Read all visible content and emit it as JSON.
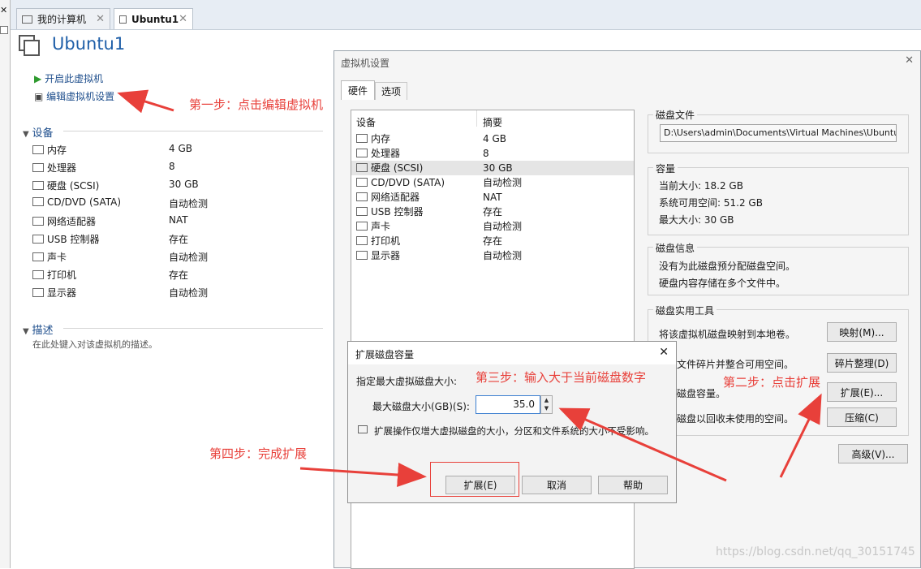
{
  "tabs": [
    {
      "label": "我的计算机"
    },
    {
      "label": "Ubuntu1"
    }
  ],
  "vm": {
    "title": "Ubuntu1",
    "start_link": "开启此虚拟机",
    "edit_link": "编辑虚拟机设置"
  },
  "devices": {
    "header": "设备",
    "items": [
      {
        "label": "内存",
        "value": "4 GB",
        "icon": "memory-icon"
      },
      {
        "label": "处理器",
        "value": "8",
        "icon": "cpu-icon"
      },
      {
        "label": "硬盘 (SCSI)",
        "value": "30 GB",
        "icon": "hard-disk-icon"
      },
      {
        "label": "CD/DVD (SATA)",
        "value": "自动检测",
        "icon": "cd-icon"
      },
      {
        "label": "网络适配器",
        "value": "NAT",
        "icon": "network-icon"
      },
      {
        "label": "USB 控制器",
        "value": "存在",
        "icon": "usb-icon"
      },
      {
        "label": "声卡",
        "value": "自动检测",
        "icon": "speaker-icon"
      },
      {
        "label": "打印机",
        "value": "存在",
        "icon": "printer-icon"
      },
      {
        "label": "显示器",
        "value": "自动检测",
        "icon": "monitor-icon"
      }
    ]
  },
  "description": {
    "header": "描述",
    "placeholder": "在此处键入对该虚拟机的描述。"
  },
  "settings": {
    "title": "虚拟机设置",
    "tabs": [
      "硬件",
      "选项"
    ],
    "col_device": "设备",
    "col_summary": "摘要",
    "hw": [
      {
        "label": "内存",
        "value": "4 GB"
      },
      {
        "label": "处理器",
        "value": "8"
      },
      {
        "label": "硬盘 (SCSI)",
        "value": "30 GB"
      },
      {
        "label": "CD/DVD (SATA)",
        "value": "自动检测"
      },
      {
        "label": "网络适配器",
        "value": "NAT"
      },
      {
        "label": "USB 控制器",
        "value": "存在"
      },
      {
        "label": "声卡",
        "value": "自动检测"
      },
      {
        "label": "打印机",
        "value": "存在"
      },
      {
        "label": "显示器",
        "value": "自动检测"
      }
    ],
    "disk_file": {
      "label": "磁盘文件",
      "value": "D:\\Users\\admin\\Documents\\Virtual Machines\\Ubuntu"
    },
    "capacity": {
      "label": "容量",
      "current": "当前大小: 18.2 GB",
      "free": "系统可用空间: 51.2 GB",
      "max": "最大大小: 30 GB"
    },
    "disk_info": {
      "label": "磁盘信息",
      "line1": "没有为此磁盘预分配磁盘空间。",
      "line2": "硬盘内容存储在多个文件中。"
    },
    "utilities": {
      "label": "磁盘实用工具",
      "map_text": "将该虚拟机磁盘映射到本地卷。",
      "map_btn": "映射(M)...",
      "defrag_text": "文件碎片并整合可用空间。",
      "defrag_btn": "碎片整理(D)",
      "expand_text": "磁盘容量。",
      "expand_btn": "扩展(E)...",
      "compact_text": "磁盘以回收未使用的空间。",
      "compact_btn": "压缩(C)"
    },
    "advanced_btn": "高级(V)..."
  },
  "expand_dialog": {
    "title": "扩展磁盘容量",
    "prompt": "指定最大虚拟磁盘大小:",
    "field_label": "最大磁盘大小(GB)(S):",
    "field_value": "35.0",
    "info": "扩展操作仅增大虚拟磁盘的大小，分区和文件系统的大小不受影响。",
    "btn_expand": "扩展(E)",
    "btn_cancel": "取消",
    "btn_help": "帮助"
  },
  "annotations": {
    "step1": "第一步：点击编辑虚拟机",
    "step2": "第二步：点击扩展",
    "step3": "第三步：输入大于当前磁盘数字",
    "step4": "第四步：完成扩展",
    "color": "#e8403a"
  },
  "watermark": "https://blog.csdn.net/qq_30151745"
}
